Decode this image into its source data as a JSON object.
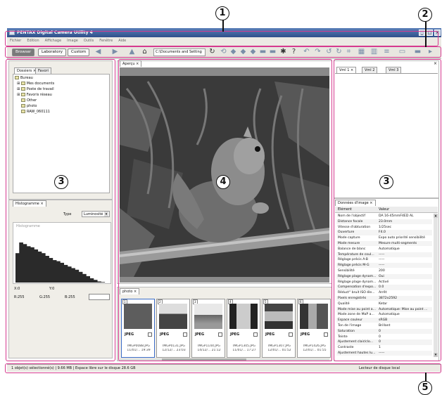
{
  "window": {
    "title": "PENTAX Digital Camera Utility 4"
  },
  "menu": [
    "Fichier",
    "Edition",
    "Affichage",
    "Image",
    "Outils",
    "Fenêtre",
    "Aide"
  ],
  "toolbar": {
    "modes": [
      "Browser",
      "Laboratory",
      "Custom"
    ],
    "path": "C:\\Documents and Setting"
  },
  "callouts": [
    "1",
    "2",
    "3",
    "4",
    "3",
    "5"
  ],
  "left_panel": {
    "tabs": [
      "Dossiers",
      "Favori"
    ],
    "tree": [
      "Bureau",
      "Mes documents",
      "Poste de travail",
      "Favoris réseau",
      "Other",
      "photo",
      "RAW_060111"
    ]
  },
  "histogram": {
    "tab": "Histogramme",
    "type_label": "Type",
    "type_value": "Luminosité",
    "chart_label": "Histogramme",
    "x_label": "X:0",
    "y_label": "Y:0",
    "r_value": "R:255",
    "g_value": "G:255",
    "b_value": "B:255",
    "fill_levels": [
      0.55,
      0.75,
      0.72,
      0.68,
      0.66,
      0.62,
      0.58,
      0.55,
      0.5,
      0.46,
      0.42,
      0.4,
      0.37,
      0.33,
      0.3,
      0.27,
      0.24,
      0.2,
      0.16,
      0.12,
      0.08,
      0.05,
      0.02,
      0.01,
      0.0
    ]
  },
  "preview": {
    "tab": "Aperçu"
  },
  "thumbnails": {
    "tab": "photo",
    "items": [
      {
        "num": "1",
        "format": "JPEG",
        "name": "IMGP0088.JPG",
        "date": "11/01/... 19:39"
      },
      {
        "num": "2",
        "format": "JPEG",
        "name": "IMGP0131.JPG",
        "date": "12/12/... 23:03"
      },
      {
        "num": "3",
        "format": "JPEG",
        "name": "IMGP1144.JPG",
        "date": "14/12/... 21:12"
      },
      {
        "num": "4",
        "format": "JPEG",
        "name": "IMGP1305.JPG",
        "date": "11/01/... 17:27"
      },
      {
        "num": "5",
        "format": "JPEG",
        "name": "IMGP1307.JPG",
        "date": "12/01/... 01:52"
      },
      {
        "num": "6",
        "format": "JPEG",
        "name": "IMGP1426.JPG",
        "date": "12/01/... 01:55"
      }
    ]
  },
  "right_top": {
    "tabs": [
      "Vml 1",
      "Vml 2",
      "Vml 3"
    ]
  },
  "image_data": {
    "tab": "Données d'image",
    "col_key": "Elément",
    "col_val": "Valeur",
    "rows": [
      [
        "Nom de l'objectif",
        "DA 16-45mmF4ED AL"
      ],
      [
        "Distance focale",
        "23.0mm"
      ],
      [
        "Vitesse d'obturation",
        "1/25sec"
      ],
      [
        "Ouverture",
        "F4.0"
      ],
      [
        "Mode capture",
        "Expo auto priorité sensibilité"
      ],
      [
        "Mode mesure",
        "Mesure multi-segments"
      ],
      [
        "Balance de blanc",
        "Automatique"
      ],
      [
        "Température de coul...",
        "-----"
      ],
      [
        "Réglage précis A-B",
        "-----"
      ],
      [
        "Réglage précis M-G",
        "-----"
      ],
      [
        "Sensibilité",
        "200"
      ],
      [
        "Réglage plage dynam...",
        "Oui"
      ],
      [
        "Réglage plage dynam...",
        "Activé"
      ],
      [
        "Compensation d'expo...",
        "0.0"
      ],
      [
        "Réduct° bruit ISO éle...",
        "Arrêt"
      ],
      [
        "Pixels enregistrés",
        "3872x2592"
      ],
      [
        "Qualité",
        "Ketar"
      ],
      [
        "Mode mise au point a...",
        "Automatique: Mise au point ..."
      ],
      [
        "Mode zone de MaP a...",
        "Automatique"
      ],
      [
        "Espace couleur",
        "sRGB"
      ],
      [
        "Ton de l'image",
        "Brillant"
      ],
      [
        "Saturation",
        "0"
      ],
      [
        "Teinte",
        "0"
      ],
      [
        "Ajustement clair/clo...",
        "0"
      ],
      [
        "Contraste",
        "1"
      ],
      [
        "Ajustement hautes lu...",
        "-----"
      ]
    ]
  },
  "status": {
    "left": "1 objet(s) sélectionné(s) | 9.66 MB | Espace libre sur le disque 28.6 GB",
    "right": "Lecteur de disque local"
  }
}
